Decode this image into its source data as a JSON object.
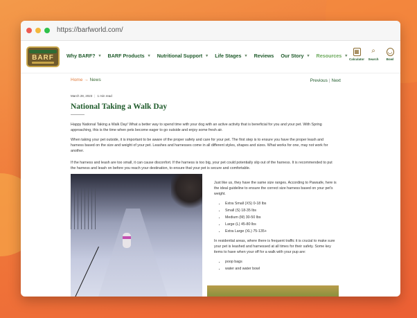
{
  "browser": {
    "url": "https://barfworld.com/"
  },
  "nav": {
    "logo_text": "BARF",
    "menu": [
      {
        "label": "Why BARF?",
        "dropdown": true
      },
      {
        "label": "BARF Products",
        "dropdown": true
      },
      {
        "label": "Nutritional Support",
        "dropdown": true
      },
      {
        "label": "Life Stages",
        "dropdown": true
      },
      {
        "label": "Reviews",
        "dropdown": false
      },
      {
        "label": "Our Story",
        "dropdown": true
      },
      {
        "label": "Resources",
        "dropdown": true
      }
    ],
    "tools": [
      {
        "label": "Calculator",
        "icon": "calculator-icon"
      },
      {
        "label": "Search",
        "icon": "search-icon"
      },
      {
        "label": "Bowl",
        "icon": "bowl-icon"
      }
    ]
  },
  "breadcrumb": {
    "home": "Home",
    "current": "News"
  },
  "pager": {
    "previous": "Previous",
    "next": "Next"
  },
  "article": {
    "date": "March 28, 2023",
    "read_time": "1 min read",
    "title": "National Taking a Walk Day",
    "paragraphs": [
      "Happy National Taking a Walk Day! What a better way to spend time with your dog with an active activity that is beneficial for you and your pet. With Spring approaching, this is the time when pets become eager to go outside and enjoy some fresh air.",
      "When taking your pet outside, it is important to be aware of the proper safety and care for your pet. The first step is to ensure you have the proper leash and harness based on the size and weight of your pet. Leashes and harnesses come in all different styles, shapes and sizes. What works for one, may not work for another.",
      "If the harness and leash are too small, it can cause disconfort. If the harness is too big, your pet could potentially slip out of the harness. It is recommended to put the harness and leash on before you reach your destination, to ensure that your pet is secure and comfortable."
    ],
    "side_intro": "Just like us, they have the same size ranges. According to Pawsafe, here is the ideal guideline to ensure the correct size harness based on your pet's weight.",
    "sizes": [
      "Extra Small (XS) 0-18 lbs",
      "Small (S) 18-35 lbs",
      "Medium (M) 30-50 lbs",
      "Large (L) 45-80 lbs",
      "Extra Large (XL) 75-135+"
    ],
    "side_para2": "In residential areas, where there is frequent traffic it is crucial to make sure your pet is leashed and harnessed at all times for their safety. Some key items to have when your off for a walk with your pup are:",
    "key_items": [
      "poop bags",
      "water and water bowl"
    ]
  }
}
